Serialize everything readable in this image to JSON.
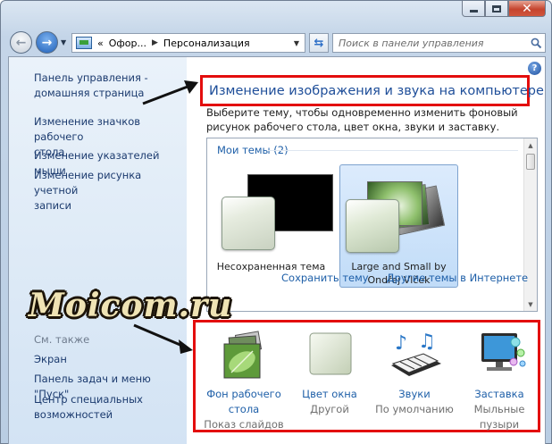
{
  "window": {
    "controls": {
      "minimize_icon": "minimize-icon",
      "maximize_icon": "maximize-icon",
      "close_icon": "close-icon"
    }
  },
  "navbar": {
    "address": {
      "prefix": "«",
      "segments": [
        "Офор...",
        "Персонализация"
      ]
    },
    "search": {
      "placeholder": "Поиск в панели управления"
    }
  },
  "sidebar": {
    "links": [
      "Панель управления -\nдомашняя страница",
      "Изменение значков рабочего\nстола",
      "Изменение указателей мыши",
      "Изменение рисунка учетной\nзаписи"
    ],
    "see_also": {
      "heading": "См. также",
      "links": [
        "Экран",
        "Панель задач и меню \"Пуск\"",
        "Центр специальных\nвозможностей"
      ]
    }
  },
  "main": {
    "title": "Изменение изображения и звука на компьютере",
    "intro": "Выберите тему, чтобы одновременно изменить фоновый рисунок рабочего стола, цвет окна, звуки и заставку.",
    "themes": {
      "group_label": "Мои темы (2)",
      "items": [
        {
          "label": "Несохраненная тема",
          "selected": false
        },
        {
          "label": "Large and Small by\nOndřej Vlček",
          "selected": true
        }
      ],
      "save_link": "Сохранить тему",
      "online_link": "Другие темы в Интернете"
    },
    "settings": [
      {
        "link": "Фон рабочего\nстола",
        "value": "Показ слайдов",
        "icon": "desktop-background-icon"
      },
      {
        "link": "Цвет окна",
        "value": "Другой",
        "icon": "window-color-icon"
      },
      {
        "link": "Звуки",
        "value": "По умолчанию",
        "icon": "sounds-icon"
      },
      {
        "link": "Заставка",
        "value": "Мыльные\nпузыри",
        "icon": "screensaver-icon"
      }
    ]
  },
  "watermark": "Moicom.ru",
  "colors": {
    "highlight_box": "#e30d0d",
    "link": "#1e5fa8",
    "title": "#1e4e99",
    "sidebar": "#dce9f6"
  }
}
